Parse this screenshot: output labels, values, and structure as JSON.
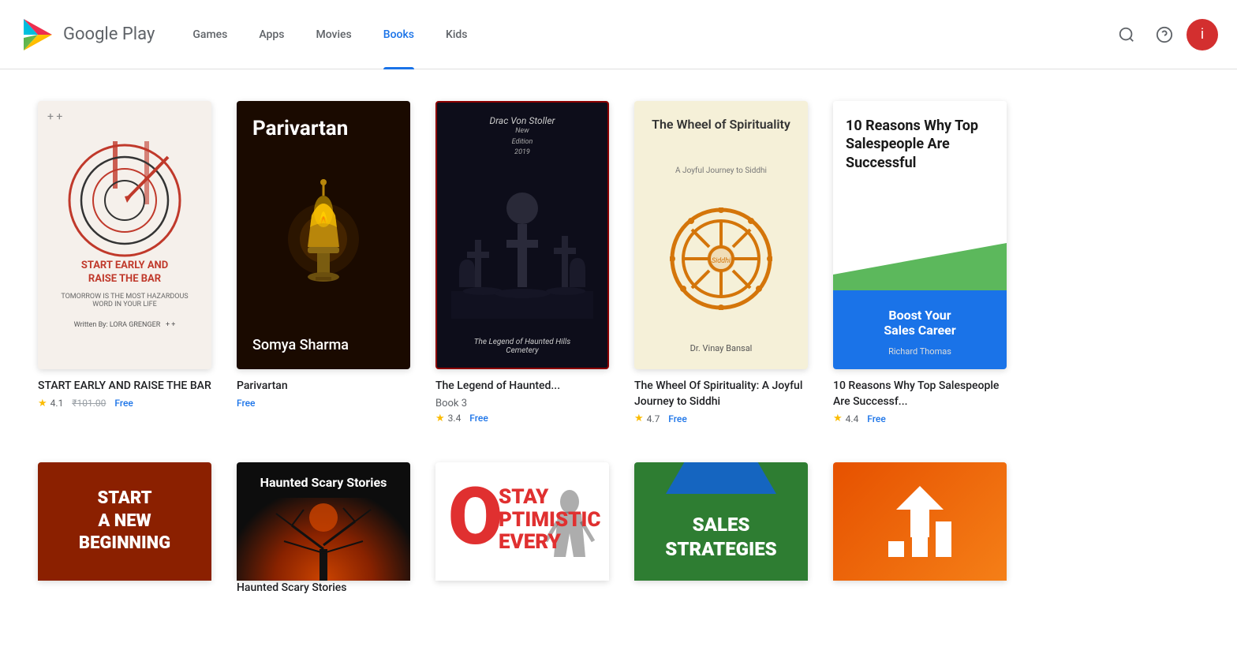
{
  "header": {
    "logo_text": "Google Play",
    "nav_items": [
      {
        "label": "Games",
        "active": false
      },
      {
        "label": "Apps",
        "active": false
      },
      {
        "label": "Movies",
        "active": false
      },
      {
        "label": "Books",
        "active": true
      },
      {
        "label": "Kids",
        "active": false
      }
    ],
    "search_title": "Search",
    "help_title": "Help",
    "avatar_letter": "i"
  },
  "row1": {
    "books": [
      {
        "title": "START EARLY AND RAISE THE BAR",
        "subtitle": "",
        "rating": "4.1",
        "original_price": "₹101.00",
        "price": "Free",
        "display_title": "START EARLY AND RAISE THE BAR"
      },
      {
        "title": "Parivartan",
        "subtitle": "Free",
        "rating": "",
        "original_price": "",
        "price": "Free",
        "display_title": "Parivartan"
      },
      {
        "title": "The Legend of Haunted...",
        "subtitle": "Book 3",
        "rating": "3.4",
        "original_price": "",
        "price": "Free",
        "display_title": "The Legend of Haunted..."
      },
      {
        "title": "The Wheel Of Spirituality: A Joyful Journey to Siddhi",
        "subtitle": "",
        "rating": "4.7",
        "original_price": "",
        "price": "Free",
        "display_title": "The Wheel Of Spirituality: A Joyful Journey to Siddhi"
      },
      {
        "title": "10 Reasons Why Top Salespeople Are Successf...",
        "subtitle": "",
        "rating": "4.4",
        "original_price": "",
        "price": "Free",
        "display_title": "10 Reasons Why Top Salespeople Are Successf..."
      }
    ]
  },
  "row2": {
    "books": [
      {
        "display_title": "Start A New Beginning",
        "cover_label": "START\nA NEW\nBEGINNING"
      },
      {
        "display_title": "Haunted Scary Stories",
        "cover_label": "Haunted Scary Stories"
      },
      {
        "display_title": "Stay Optimistic Every...",
        "cover_label": "STAY OPTIMISTIC EVERY"
      },
      {
        "display_title": "Sales Strategies",
        "cover_label": "SALES STRATEGIES"
      },
      {
        "display_title": "Growth Chart",
        "cover_label": ""
      }
    ]
  }
}
